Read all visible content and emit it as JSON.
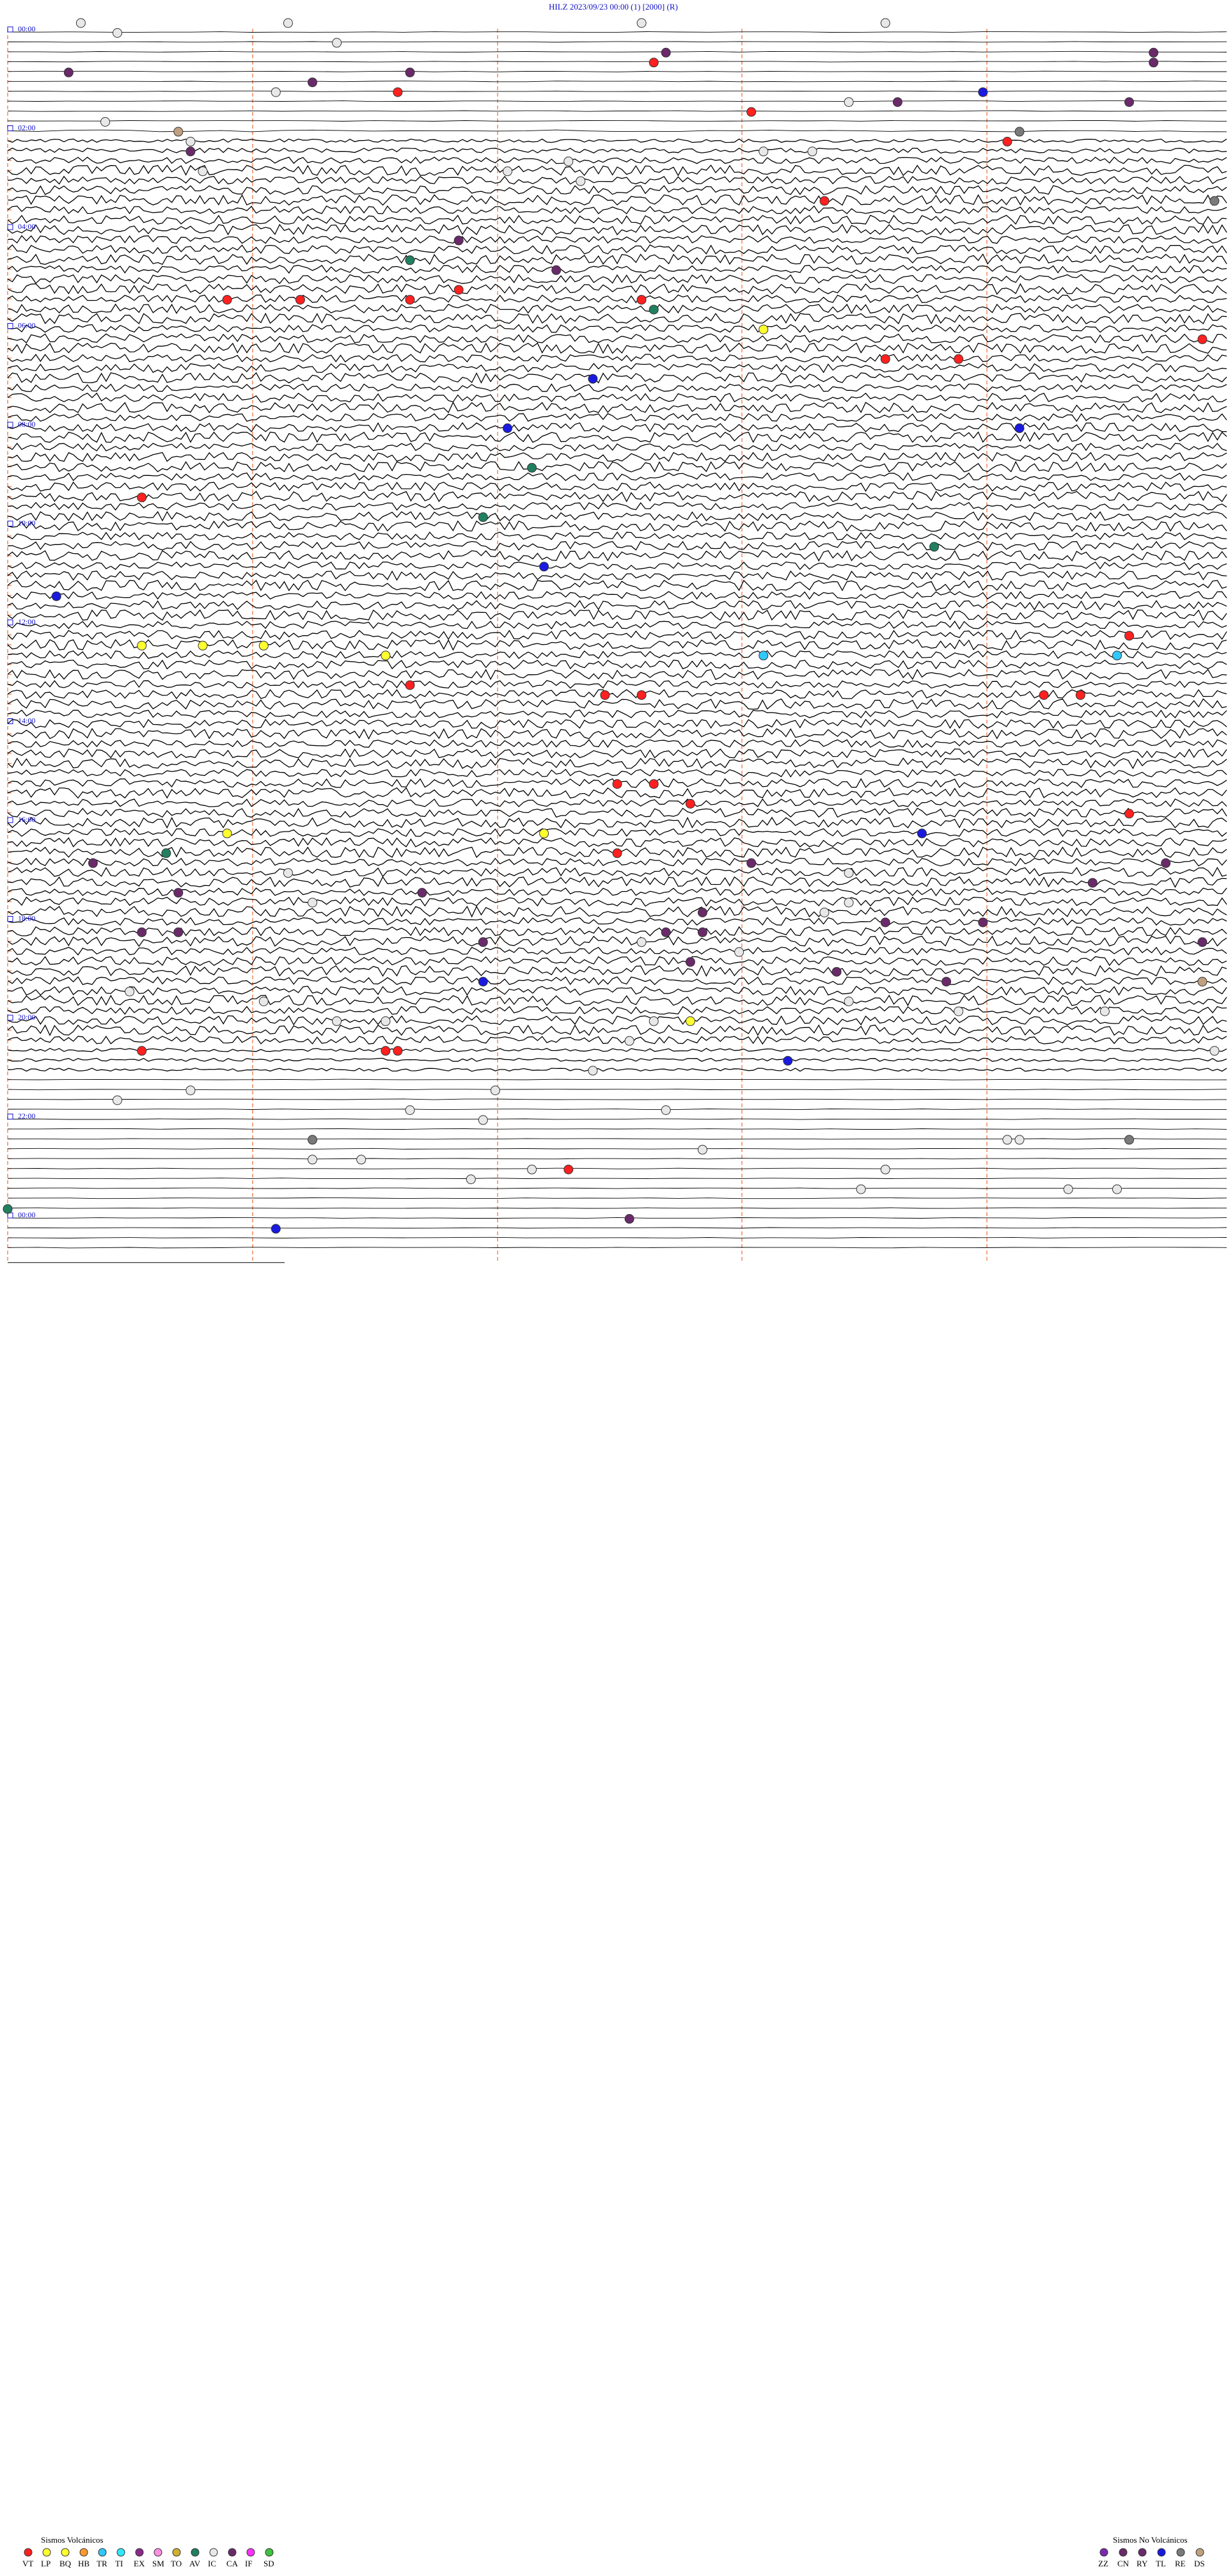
{
  "header": {
    "station": "HILZ",
    "datetime": "2023/09/23 00:00",
    "field1": "(1)",
    "field2": "[2000]",
    "field3": "(R)"
  },
  "hour_labels": [
    "00:00",
    "02:00",
    "04:00",
    "06:00",
    "08:00",
    "10:00",
    "12:00",
    "14:00",
    "16:00",
    "18:00",
    "20:00",
    "22:00",
    "00:00"
  ],
  "legend": {
    "volcanic_title": "Sismos Volcánicos",
    "volcanic": [
      {
        "code": "VT",
        "color": "#ff2020"
      },
      {
        "code": "LP",
        "color": "#ffff30"
      },
      {
        "code": "BQ",
        "color": "#ffff30"
      },
      {
        "code": "HB",
        "color": "#ff9a30"
      },
      {
        "code": "TR",
        "color": "#30c8ff"
      },
      {
        "code": "TI",
        "color": "#30e8ff"
      },
      {
        "code": "EX",
        "color": "#8a2a8a"
      },
      {
        "code": "SM",
        "color": "#ff90e0"
      },
      {
        "code": "TO",
        "color": "#d0b030"
      },
      {
        "code": "AV",
        "color": "#208060"
      },
      {
        "code": "IC",
        "color": "#e8e8e8"
      },
      {
        "code": "CA",
        "color": "#6a2a6a"
      },
      {
        "code": "IF",
        "color": "#ff30ff"
      },
      {
        "code": "SD",
        "color": "#40c040"
      }
    ],
    "nonvolcanic_title": "Sismos No Volcánicos",
    "nonvolcanic": [
      {
        "code": "ZZ",
        "color": "#7a2ab0"
      },
      {
        "code": "CN",
        "color": "#6a2a6a"
      },
      {
        "code": "RY",
        "color": "#6a2a6a"
      },
      {
        "code": "TL",
        "color": "#1a1ae0"
      },
      {
        "code": "RE",
        "color": "#7a7a7a"
      },
      {
        "code": "DS",
        "color": "#c0a080"
      }
    ]
  },
  "chart_data": {
    "type": "helicorder",
    "hours": 24,
    "title": "HILZ 2023/09/23 00:00 (1) [2000] (R)",
    "events": [
      {
        "line": 0,
        "x": 0.06,
        "class": "IC"
      },
      {
        "line": 1,
        "x": 0.09,
        "class": "IC"
      },
      {
        "line": 0,
        "x": 0.23,
        "class": "IC"
      },
      {
        "line": 2,
        "x": 0.27,
        "class": "IC"
      },
      {
        "line": 0,
        "x": 0.52,
        "class": "IC"
      },
      {
        "line": 0,
        "x": 0.72,
        "class": "IC"
      },
      {
        "line": 3,
        "x": 0.54,
        "class": "CA"
      },
      {
        "line": 4,
        "x": 0.53,
        "class": "VT"
      },
      {
        "line": 3,
        "x": 0.94,
        "class": "CA"
      },
      {
        "line": 4,
        "x": 0.94,
        "class": "CA"
      },
      {
        "line": 5,
        "x": 0.05,
        "class": "CA"
      },
      {
        "line": 5,
        "x": 0.33,
        "class": "CA"
      },
      {
        "line": 6,
        "x": 0.25,
        "class": "CA"
      },
      {
        "line": 7,
        "x": 0.22,
        "class": "IC"
      },
      {
        "line": 7,
        "x": 0.32,
        "class": "VT"
      },
      {
        "line": 7,
        "x": 0.8,
        "class": "TL"
      },
      {
        "line": 8,
        "x": 0.69,
        "class": "IC"
      },
      {
        "line": 8,
        "x": 0.73,
        "class": "CA"
      },
      {
        "line": 8,
        "x": 0.92,
        "class": "CA"
      },
      {
        "line": 9,
        "x": 0.61,
        "class": "VT"
      },
      {
        "line": 10,
        "x": 0.08,
        "class": "IC"
      },
      {
        "line": 11,
        "x": 0.14,
        "class": "DS"
      },
      {
        "line": 11,
        "x": 0.83,
        "class": "RE"
      },
      {
        "line": 12,
        "x": 0.15,
        "class": "IC"
      },
      {
        "line": 12,
        "x": 0.82,
        "class": "VT"
      },
      {
        "line": 13,
        "x": 0.15,
        "class": "CA"
      },
      {
        "line": 13,
        "x": 0.62,
        "class": "IC"
      },
      {
        "line": 13,
        "x": 0.66,
        "class": "IC"
      },
      {
        "line": 14,
        "x": 0.46,
        "class": "IC"
      },
      {
        "line": 15,
        "x": 0.16,
        "class": "IC"
      },
      {
        "line": 15,
        "x": 0.41,
        "class": "IC"
      },
      {
        "line": 16,
        "x": 0.47,
        "class": "IC"
      },
      {
        "line": 18,
        "x": 0.67,
        "class": "VT"
      },
      {
        "line": 18,
        "x": 0.99,
        "class": "RE"
      },
      {
        "line": 22,
        "x": 0.37,
        "class": "CA"
      },
      {
        "line": 24,
        "x": 0.33,
        "class": "AV"
      },
      {
        "line": 25,
        "x": 0.45,
        "class": "CA"
      },
      {
        "line": 27,
        "x": 0.37,
        "class": "VT"
      },
      {
        "line": 28,
        "x": 0.18,
        "class": "VT"
      },
      {
        "line": 28,
        "x": 0.24,
        "class": "VT"
      },
      {
        "line": 28,
        "x": 0.33,
        "class": "VT"
      },
      {
        "line": 28,
        "x": 0.52,
        "class": "VT"
      },
      {
        "line": 29,
        "x": 0.53,
        "class": "AV"
      },
      {
        "line": 31,
        "x": 0.62,
        "class": "LP"
      },
      {
        "line": 32,
        "x": 0.98,
        "class": "VT"
      },
      {
        "line": 34,
        "x": 0.72,
        "class": "VT"
      },
      {
        "line": 34,
        "x": 0.78,
        "class": "VT"
      },
      {
        "line": 36,
        "x": 0.48,
        "class": "TL"
      },
      {
        "line": 41,
        "x": 0.41,
        "class": "TL"
      },
      {
        "line": 41,
        "x": 0.83,
        "class": "TL"
      },
      {
        "line": 45,
        "x": 0.43,
        "class": "AV"
      },
      {
        "line": 48,
        "x": 0.11,
        "class": "VT"
      },
      {
        "line": 50,
        "x": 0.39,
        "class": "AV"
      },
      {
        "line": 53,
        "x": 0.76,
        "class": "AV"
      },
      {
        "line": 55,
        "x": 0.44,
        "class": "TL"
      },
      {
        "line": 58,
        "x": 0.04,
        "class": "TL"
      },
      {
        "line": 62,
        "x": 0.92,
        "class": "VT"
      },
      {
        "line": 63,
        "x": 0.11,
        "class": "LP"
      },
      {
        "line": 63,
        "x": 0.16,
        "class": "LP"
      },
      {
        "line": 63,
        "x": 0.21,
        "class": "LP"
      },
      {
        "line": 64,
        "x": 0.31,
        "class": "LP"
      },
      {
        "line": 64,
        "x": 0.62,
        "class": "TR"
      },
      {
        "line": 64,
        "x": 0.91,
        "class": "TR"
      },
      {
        "line": 67,
        "x": 0.33,
        "class": "VT"
      },
      {
        "line": 68,
        "x": 0.49,
        "class": "VT"
      },
      {
        "line": 68,
        "x": 0.52,
        "class": "VT"
      },
      {
        "line": 68,
        "x": 0.85,
        "class": "VT"
      },
      {
        "line": 68,
        "x": 0.88,
        "class": "VT"
      },
      {
        "line": 77,
        "x": 0.5,
        "class": "VT"
      },
      {
        "line": 77,
        "x": 0.53,
        "class": "VT"
      },
      {
        "line": 79,
        "x": 0.56,
        "class": "VT"
      },
      {
        "line": 80,
        "x": 0.92,
        "class": "VT"
      },
      {
        "line": 82,
        "x": 0.18,
        "class": "LP"
      },
      {
        "line": 82,
        "x": 0.44,
        "class": "LP"
      },
      {
        "line": 82,
        "x": 0.75,
        "class": "TL"
      },
      {
        "line": 84,
        "x": 0.5,
        "class": "VT"
      },
      {
        "line": 84,
        "x": 0.13,
        "class": "AV"
      },
      {
        "line": 85,
        "x": 0.07,
        "class": "CA"
      },
      {
        "line": 85,
        "x": 0.61,
        "class": "CA"
      },
      {
        "line": 85,
        "x": 0.95,
        "class": "CA"
      },
      {
        "line": 86,
        "x": 0.23,
        "class": "IC"
      },
      {
        "line": 86,
        "x": 0.69,
        "class": "IC"
      },
      {
        "line": 87,
        "x": 0.89,
        "class": "CA"
      },
      {
        "line": 88,
        "x": 0.14,
        "class": "CA"
      },
      {
        "line": 88,
        "x": 0.34,
        "class": "CA"
      },
      {
        "line": 89,
        "x": 0.25,
        "class": "IC"
      },
      {
        "line": 89,
        "x": 0.69,
        "class": "IC"
      },
      {
        "line": 90,
        "x": 0.57,
        "class": "CA"
      },
      {
        "line": 90,
        "x": 0.67,
        "class": "IC"
      },
      {
        "line": 91,
        "x": 0.72,
        "class": "CA"
      },
      {
        "line": 91,
        "x": 0.8,
        "class": "CA"
      },
      {
        "line": 92,
        "x": 0.11,
        "class": "CA"
      },
      {
        "line": 92,
        "x": 0.14,
        "class": "CA"
      },
      {
        "line": 92,
        "x": 0.54,
        "class": "CA"
      },
      {
        "line": 92,
        "x": 0.57,
        "class": "CA"
      },
      {
        "line": 93,
        "x": 0.39,
        "class": "CA"
      },
      {
        "line": 93,
        "x": 0.52,
        "class": "IC"
      },
      {
        "line": 93,
        "x": 0.98,
        "class": "CA"
      },
      {
        "line": 94,
        "x": 0.6,
        "class": "IC"
      },
      {
        "line": 95,
        "x": 0.56,
        "class": "CA"
      },
      {
        "line": 96,
        "x": 0.68,
        "class": "CA"
      },
      {
        "line": 97,
        "x": 0.39,
        "class": "TL"
      },
      {
        "line": 97,
        "x": 0.77,
        "class": "CA"
      },
      {
        "line": 97,
        "x": 0.98,
        "class": "DS"
      },
      {
        "line": 98,
        "x": 0.1,
        "class": "IC"
      },
      {
        "line": 99,
        "x": 0.21,
        "class": "IC"
      },
      {
        "line": 99,
        "x": 0.69,
        "class": "IC"
      },
      {
        "line": 100,
        "x": 0.78,
        "class": "IC"
      },
      {
        "line": 100,
        "x": 0.9,
        "class": "IC"
      },
      {
        "line": 101,
        "x": 0.27,
        "class": "IC"
      },
      {
        "line": 101,
        "x": 0.31,
        "class": "IC"
      },
      {
        "line": 101,
        "x": 0.53,
        "class": "IC"
      },
      {
        "line": 101,
        "x": 0.56,
        "class": "LP"
      },
      {
        "line": 103,
        "x": 0.51,
        "class": "IC"
      },
      {
        "line": 104,
        "x": 0.11,
        "class": "VT"
      },
      {
        "line": 104,
        "x": 0.31,
        "class": "VT"
      },
      {
        "line": 104,
        "x": 0.32,
        "class": "VT"
      },
      {
        "line": 104,
        "x": 0.99,
        "class": "IC"
      },
      {
        "line": 105,
        "x": 0.64,
        "class": "TL"
      },
      {
        "line": 106,
        "x": 0.48,
        "class": "IC"
      },
      {
        "line": 108,
        "x": 0.15,
        "class": "IC"
      },
      {
        "line": 108,
        "x": 0.4,
        "class": "IC"
      },
      {
        "line": 109,
        "x": 0.09,
        "class": "IC"
      },
      {
        "line": 110,
        "x": 0.33,
        "class": "IC"
      },
      {
        "line": 110,
        "x": 0.54,
        "class": "IC"
      },
      {
        "line": 111,
        "x": 0.39,
        "class": "IC"
      },
      {
        "line": 113,
        "x": 0.25,
        "class": "RE"
      },
      {
        "line": 113,
        "x": 0.82,
        "class": "IC"
      },
      {
        "line": 113,
        "x": 0.83,
        "class": "IC"
      },
      {
        "line": 113,
        "x": 0.92,
        "class": "RE"
      },
      {
        "line": 114,
        "x": 0.57,
        "class": "IC"
      },
      {
        "line": 115,
        "x": 0.25,
        "class": "IC"
      },
      {
        "line": 115,
        "x": 0.29,
        "class": "IC"
      },
      {
        "line": 116,
        "x": 0.43,
        "class": "IC"
      },
      {
        "line": 116,
        "x": 0.72,
        "class": "IC"
      },
      {
        "line": 116,
        "x": 0.46,
        "class": "VT"
      },
      {
        "line": 117,
        "x": 0.38,
        "class": "IC"
      },
      {
        "line": 118,
        "x": 0.87,
        "class": "IC"
      },
      {
        "line": 118,
        "x": 0.91,
        "class": "IC"
      },
      {
        "line": 118,
        "x": 0.7,
        "class": "IC"
      },
      {
        "line": 120,
        "x": 0.0,
        "class": "AV"
      },
      {
        "line": 121,
        "x": 0.51,
        "class": "CA"
      },
      {
        "line": 122,
        "x": 0.22,
        "class": "TL"
      }
    ]
  }
}
